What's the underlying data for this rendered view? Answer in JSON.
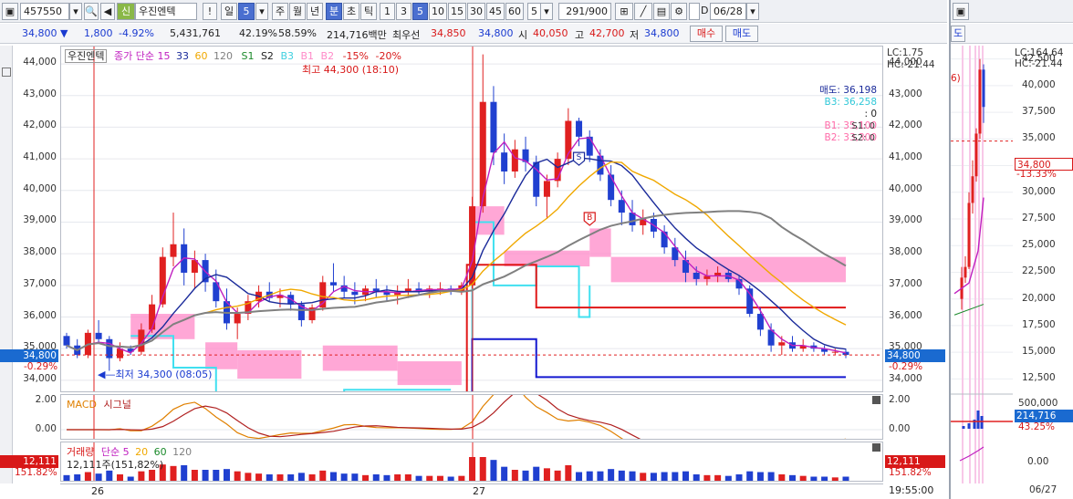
{
  "toolbar": {
    "code": "457550",
    "credit_badge": "신",
    "name": "우진엔텍",
    "warn": "!",
    "period_day": "일",
    "period_num": "5",
    "p_week": "주",
    "p_month": "월",
    "p_year": "년",
    "p_min": "분",
    "p_sec": "초",
    "p_tick": "틱",
    "intervals": [
      "1",
      "3",
      "5",
      "10",
      "15",
      "30",
      "45",
      "60"
    ],
    "count_value": "5",
    "count_range": "291/900",
    "d_label": "D",
    "date": "06/28"
  },
  "price_row": {
    "price": "34,800",
    "arrow": "▼",
    "change": "1,800",
    "rate": "-4.92%",
    "volume": "5,431,761",
    "ratio1": "42.19%",
    "ratio2": "58.59%",
    "amount": "214,716백만",
    "quote_label": "최우선",
    "ask": "34,850",
    "bid": "34,800",
    "open_label": "시",
    "open": "40,050",
    "high_label": "고",
    "high": "42,700",
    "low_label": "저",
    "low": "34,800",
    "buy_button": "매수",
    "sell_button": "매도"
  },
  "main_chart": {
    "legend": {
      "name": "우진엔텍",
      "ma_title": "종가 단순",
      "ma_periods": [
        "15",
        "33",
        "60",
        "120"
      ],
      "s1": "S1",
      "s2": "S2",
      "b3": "B3",
      "b1": "B1",
      "b2": "B2",
      "pct1": "-15%",
      "pct2": "-20%"
    },
    "lc": "LC:1.75",
    "hc": "HC:-21.44",
    "high_note": "최고 44,300 (18:10)",
    "low_note": "최저 34,300 (08:05)",
    "order_info": [
      "매도: 36,198",
      "B3: 36,258",
      ": 0",
      "B1: 35,100",
      "B2: 33,300"
    ],
    "order_info_side": [
      "S1: 0",
      "S2: 0"
    ],
    "current_tag": "34,800",
    "current_pct": "-0.29%",
    "y_ticks": [
      "44,000",
      "43,000",
      "42,000",
      "41,000",
      "40,000",
      "39,000",
      "38,000",
      "37,000",
      "36,000",
      "35,000",
      "34,000"
    ]
  },
  "macd_panel": {
    "label_macd": "MACD",
    "label_signal": "시그널",
    "y_ticks": [
      "2.00",
      "0.00",
      "-2.00"
    ]
  },
  "volume_panel": {
    "label": "거래량",
    "ma_title": "단순",
    "ma_periods": [
      "5",
      "20",
      "60",
      "120"
    ],
    "current_value": "12,111주(151,82%)",
    "tag_value": "12,111",
    "tag_pct": "151.82%"
  },
  "x_axis": {
    "day1": "26",
    "day2": "27",
    "time": "19:55:00"
  },
  "right_pane": {
    "top_tab": "도",
    "lc": "LC:164.64",
    "hc": "HC:-21.44",
    "top_note": "6)",
    "y_ticks": [
      "42,500",
      "40,000",
      "37,500",
      "35,000",
      "32,500",
      "30,000",
      "27,500",
      "25,000",
      "22,500",
      "20,000",
      "17,500",
      "15,000",
      "12,500"
    ],
    "current_tag": "34,800",
    "current_pct": "-13.33%",
    "vol_ticks": [
      "500,000",
      "0.00"
    ],
    "vol_tag": "214,716",
    "vol_pct": "43.25%",
    "date_label": "06/27"
  },
  "colors": {
    "up": "#e02020",
    "down": "#2040d0",
    "ma15": "#c020c0",
    "ma33": "#1a2a9a",
    "ma60": "#f0a800",
    "ma120": "#808080",
    "pink_zone": "#ff8ac8",
    "cyan_line": "#40e0f0",
    "red_line": "#e01818",
    "blue_line": "#1418d0"
  },
  "chart_data": [
    {
      "type": "line",
      "title": "",
      "x": [
        "26",
        "27"
      ],
      "series": [
        {
          "name": "15",
          "values": []
        },
        {
          "name": "33",
          "values": []
        },
        {
          "name": "60",
          "values": []
        },
        {
          "name": "120",
          "values": []
        }
      ],
      "candles_ohlc": [
        [
          35400,
          35500,
          35000,
          35100
        ],
        [
          35100,
          35300,
          34700,
          34800
        ],
        [
          34800,
          35600,
          34700,
          35500
        ],
        [
          35500,
          35900,
          35200,
          35300
        ],
        [
          35300,
          35400,
          34300,
          34700
        ],
        [
          34700,
          35200,
          34600,
          35000
        ],
        [
          35000,
          35100,
          34800,
          34900
        ],
        [
          34900,
          35800,
          34800,
          35600
        ],
        [
          35600,
          36700,
          35500,
          36400
        ],
        [
          36400,
          38200,
          36300,
          37900
        ],
        [
          37900,
          39300,
          37600,
          38300
        ],
        [
          38300,
          38800,
          37000,
          37400
        ],
        [
          37400,
          38100,
          36900,
          37800
        ],
        [
          37800,
          38000,
          36800,
          37100
        ],
        [
          37100,
          37500,
          36300,
          36500
        ],
        [
          36500,
          36900,
          35600,
          35800
        ],
        [
          35800,
          36300,
          35300,
          36100
        ],
        [
          36100,
          36700,
          35900,
          36500
        ],
        [
          36500,
          37000,
          36300,
          36800
        ],
        [
          36800,
          37100,
          36500,
          36600
        ],
        [
          36600,
          36900,
          36300,
          36700
        ],
        [
          36700,
          36800,
          36200,
          36400
        ],
        [
          36400,
          36500,
          35700,
          35900
        ],
        [
          35900,
          36400,
          35800,
          36300
        ],
        [
          36300,
          37300,
          36200,
          37100
        ],
        [
          37100,
          37700,
          36800,
          37000
        ],
        [
          37000,
          37300,
          36600,
          36800
        ],
        [
          36800,
          37100,
          36400,
          36700
        ],
        [
          36700,
          37000,
          36500,
          36900
        ],
        [
          36900,
          37200,
          36600,
          36800
        ],
        [
          36800,
          37000,
          36500,
          36700
        ],
        [
          36700,
          37000,
          36400,
          36800
        ],
        [
          36800,
          37200,
          36600,
          36900
        ],
        [
          36900,
          37100,
          36700,
          36800
        ],
        [
          36800,
          37000,
          36600,
          36900
        ],
        [
          36900,
          37100,
          36700,
          36900
        ],
        [
          36900,
          37000,
          36700,
          36800
        ],
        [
          36800,
          37100,
          36700,
          37000
        ],
        [
          37000,
          39800,
          36900,
          39500
        ],
        [
          39500,
          44300,
          39300,
          42800
        ],
        [
          42800,
          43300,
          40800,
          41200
        ],
        [
          41200,
          41800,
          40200,
          40600
        ],
        [
          40600,
          41600,
          40400,
          41300
        ],
        [
          41300,
          41700,
          40600,
          40900
        ],
        [
          40900,
          41100,
          39500,
          39800
        ],
        [
          39800,
          40500,
          39100,
          40300
        ],
        [
          40300,
          41200,
          40100,
          41000
        ],
        [
          41000,
          42600,
          40800,
          42200
        ],
        [
          42200,
          42300,
          41400,
          41700
        ],
        [
          41700,
          41900,
          40900,
          41100
        ],
        [
          41100,
          41300,
          40300,
          40500
        ],
        [
          40500,
          40800,
          39500,
          39700
        ],
        [
          39700,
          40000,
          38900,
          39300
        ],
        [
          39300,
          39700,
          38700,
          38900
        ],
        [
          38900,
          39400,
          38600,
          39100
        ],
        [
          39100,
          39300,
          38500,
          38700
        ],
        [
          38700,
          38900,
          38000,
          38200
        ],
        [
          38200,
          38500,
          37600,
          37800
        ],
        [
          37800,
          38100,
          37100,
          37400
        ],
        [
          37400,
          37600,
          37000,
          37200
        ],
        [
          37200,
          37500,
          37000,
          37300
        ],
        [
          37300,
          37600,
          37100,
          37400
        ],
        [
          37400,
          37500,
          37100,
          37200
        ],
        [
          37200,
          37300,
          36700,
          36900
        ],
        [
          36900,
          37000,
          36000,
          36100
        ],
        [
          36100,
          36300,
          35400,
          35600
        ],
        [
          35600,
          35800,
          34900,
          35100
        ],
        [
          35100,
          35400,
          34800,
          35200
        ],
        [
          35200,
          35400,
          34900,
          35000
        ],
        [
          35000,
          35300,
          34900,
          35100
        ],
        [
          35100,
          35200,
          34900,
          35000
        ],
        [
          35000,
          35100,
          34800,
          34900
        ],
        [
          34900,
          35000,
          34800,
          34900
        ],
        [
          34900,
          35000,
          34700,
          34800
        ]
      ]
    }
  ]
}
